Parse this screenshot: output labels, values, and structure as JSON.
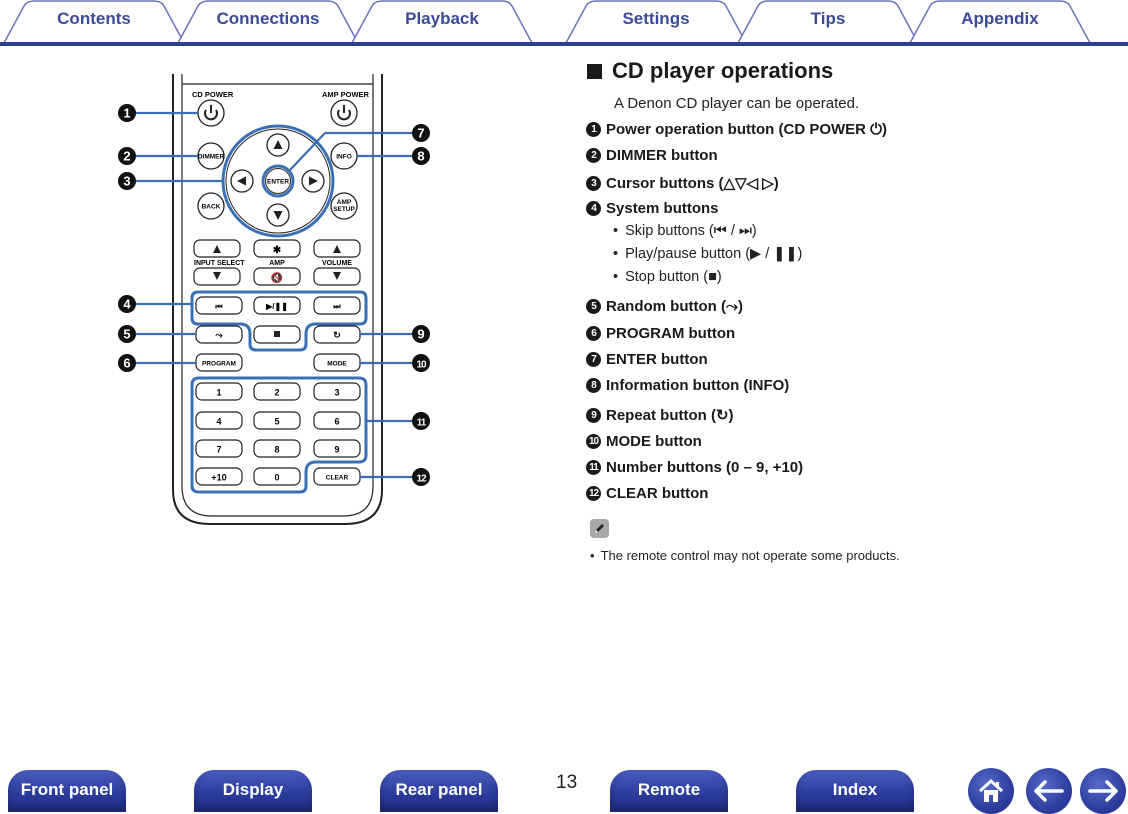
{
  "tabs": [
    {
      "label": "Contents"
    },
    {
      "label": "Connections"
    },
    {
      "label": "Playback"
    },
    {
      "label": "Settings"
    },
    {
      "label": "Tips"
    },
    {
      "label": "Appendix"
    }
  ],
  "section": {
    "title": "CD player operations",
    "intro": "A Denon CD player can be operated.",
    "items": [
      {
        "num": "1",
        "label": "Power operation button (CD POWER ⏻)"
      },
      {
        "num": "2",
        "label": "DIMMER button"
      },
      {
        "num": "3",
        "label": "Cursor buttons (△▽◁ ▷)"
      },
      {
        "num": "4",
        "label": "System buttons"
      },
      {
        "num": "5",
        "label": "Random button (⤳)"
      },
      {
        "num": "6",
        "label": "PROGRAM button"
      },
      {
        "num": "7",
        "label": "ENTER button"
      },
      {
        "num": "8",
        "label": "Information button (INFO)"
      },
      {
        "num": "9",
        "label": "Repeat button (↻)"
      },
      {
        "num": "10",
        "label": "MODE button"
      },
      {
        "num": "11",
        "label": "Number buttons (0 – 9, +10)"
      },
      {
        "num": "12",
        "label": "CLEAR button"
      }
    ],
    "system_bullets": [
      "Skip buttons (⏮ / ⏭)",
      "Play/pause button (▶ / ❚❚)",
      "Stop button (■)"
    ],
    "note_icon": "pencil-icon",
    "note": "The remote control may not operate some products."
  },
  "remote": {
    "cd_power": "CD POWER",
    "amp_power": "AMP POWER",
    "dimmer": "DIMMER",
    "info": "INFO",
    "enter": "ENTER",
    "back": "BACK",
    "amp_setup_1": "AMP",
    "amp_setup_2": "SETUP",
    "input_select": "INPUT SELECT",
    "amp": "AMP",
    "volume": "VOLUME",
    "program": "PROGRAM",
    "mode": "MODE",
    "clear": "CLEAR",
    "plus10": "+10",
    "digits": [
      "1",
      "2",
      "3",
      "4",
      "5",
      "6",
      "7",
      "8",
      "9",
      "0"
    ],
    "callouts": [
      "1",
      "2",
      "3",
      "4",
      "5",
      "6",
      "7",
      "8",
      "9",
      "10",
      "11",
      "12"
    ],
    "highlight_color": "#3a6fb5"
  },
  "page_number": "13",
  "bottom_nav": [
    {
      "label": "Front panel"
    },
    {
      "label": "Display"
    },
    {
      "label": "Rear panel"
    },
    {
      "label": "Remote"
    },
    {
      "label": "Index"
    }
  ],
  "icons": {
    "home": "home-icon",
    "back": "arrow-left-icon",
    "forward": "arrow-right-icon"
  }
}
